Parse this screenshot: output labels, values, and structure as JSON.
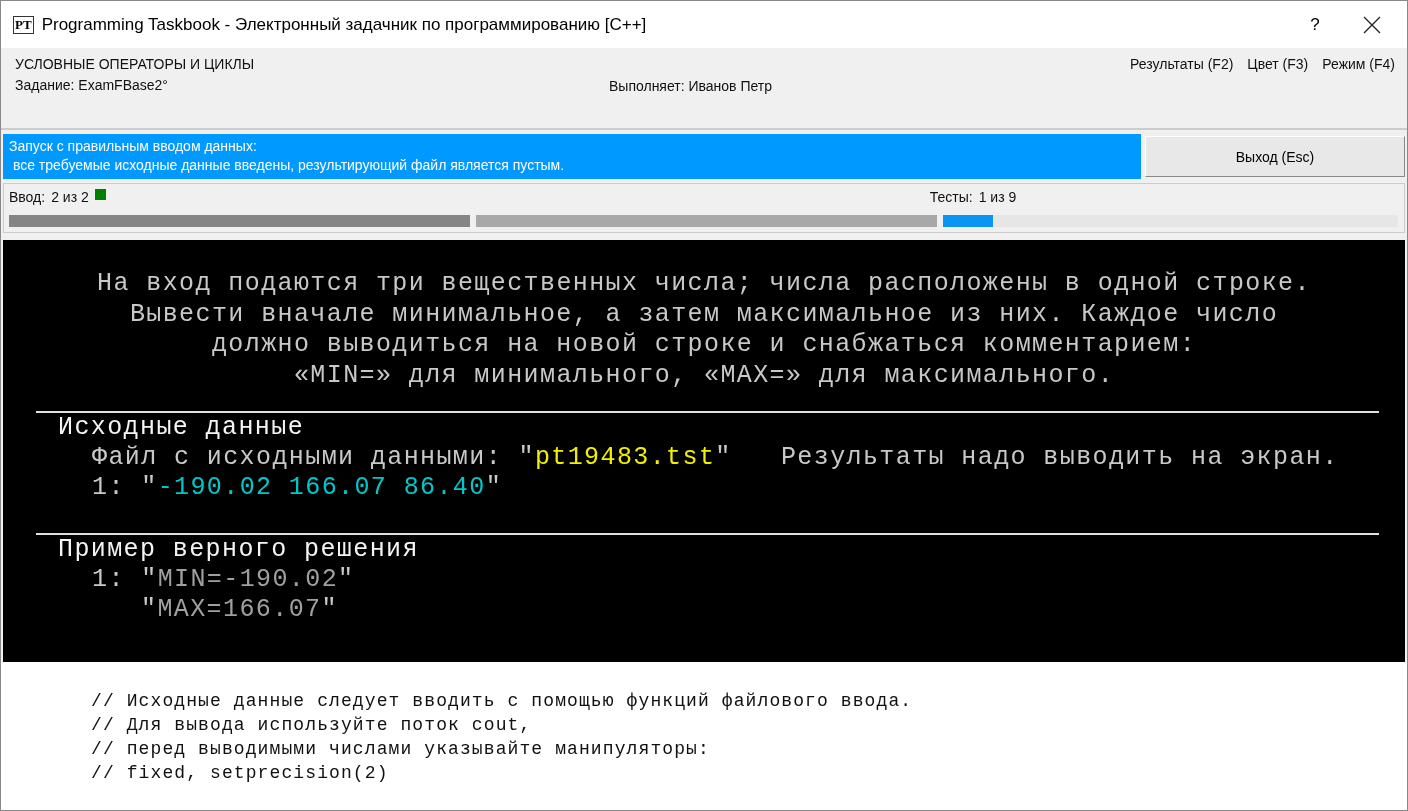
{
  "window": {
    "icon_label": "PT",
    "title": "Programming Taskbook - Электронный задачник по программированию [C++]",
    "help_button": "?"
  },
  "header": {
    "group": "УСЛОВНЫЕ ОПЕРАТОРЫ И ЦИКЛЫ",
    "task": "Задание: ExamFBase2°",
    "student": "Выполняет: Иванов Петр",
    "menu": [
      "Результаты (F2)",
      "Цвет (F3)",
      "Режим (F4)"
    ]
  },
  "status": {
    "lines": [
      "Запуск с правильным вводом данных:",
      " все требуемые исходные данные введены, результирующий файл является пустым."
    ]
  },
  "exit_button": "Выход (Esc)",
  "progress": {
    "input_label": "Ввод:",
    "input_value": "2 из 2",
    "input_done": true,
    "tests_label": "Тесты:",
    "tests_value": "1 из 9",
    "bars": [
      {
        "kind": "input",
        "level": 1
      },
      {
        "kind": "output",
        "level": 1
      },
      {
        "kind": "tests",
        "level": 0.11
      }
    ]
  },
  "console": {
    "task_lines": [
      "На вход подаются три вещественных числа; числа расположены в одной строке.",
      "Вывести вначале минимальное, а затем максимальное из них. Каждое число",
      "должно выводиться на новой строке и снабжаться комментарием:",
      "«MIN=» для минимального, «MAX=» для максимального."
    ],
    "sections": [
      {
        "heading": "Исходные данные",
        "lines": [
          {
            "kind": "item",
            "segments": [
              {
                "kind": "label",
                "text": "Файл с исходными данными: \""
              },
              {
                "kind": "file",
                "text": "pt19483.tst"
              },
              {
                "kind": "label",
                "text": "\"   Результаты надо выводить на экран."
              }
            ]
          },
          {
            "kind": "item",
            "segments": [
              {
                "kind": "label",
                "text": "1: \""
              },
              {
                "kind": "input",
                "text": "-190.02 166.07 86.40"
              },
              {
                "kind": "label",
                "text": "\""
              }
            ]
          }
        ]
      },
      {
        "heading": "Пример верного решения",
        "lines": [
          {
            "kind": "item",
            "segments": [
              {
                "kind": "label",
                "text": "1: \""
              },
              {
                "kind": "output",
                "text": "MIN=-190.02"
              },
              {
                "kind": "label",
                "text": "\""
              }
            ]
          },
          {
            "kind": "continuation",
            "segments": [
              {
                "kind": "label",
                "text": "\""
              },
              {
                "kind": "output",
                "text": "MAX=166.07"
              },
              {
                "kind": "label",
                "text": "\""
              }
            ]
          }
        ]
      }
    ]
  },
  "comments": [
    "// Исходные данные следует вводить с помощью функций файлового ввода.",
    "// Для вывода используйте поток cout,",
    "// перед выводимыми числами указывайте манипуляторы:",
    "// fixed, setprecision(2)"
  ]
}
